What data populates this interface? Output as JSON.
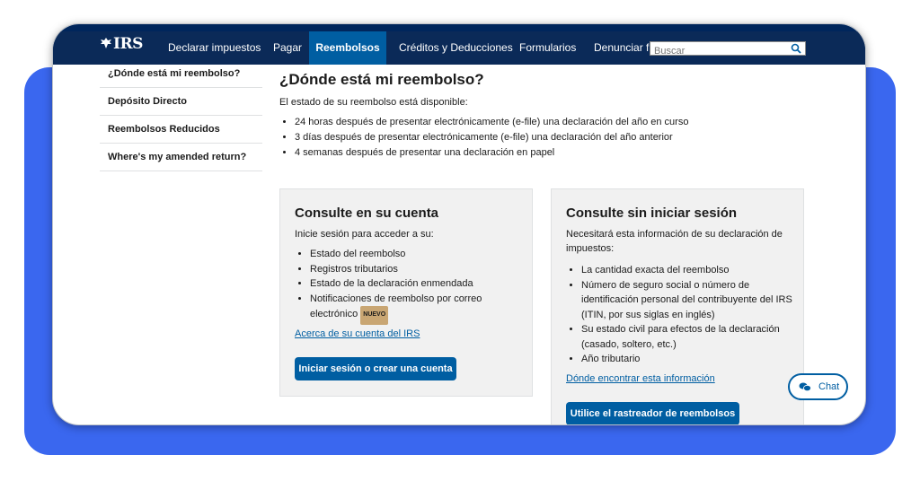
{
  "nav": {
    "logo": "IRS",
    "items": [
      {
        "label": "Declarar impuestos",
        "active": false
      },
      {
        "label": "Pagar",
        "active": false
      },
      {
        "label": "Reembolsos",
        "active": true
      },
      {
        "label": "Créditos y Deducciones",
        "active": false
      },
      {
        "label": "Formularios",
        "active": false
      },
      {
        "label": "Denunciar fra",
        "active": false
      }
    ],
    "search_placeholder": "Buscar"
  },
  "sidebar": {
    "items": [
      {
        "label": "¿Dónde está mi reembolso?"
      },
      {
        "label": "Depósito Directo"
      },
      {
        "label": "Reembolsos Reducidos"
      },
      {
        "label": "Where's my amended return?"
      }
    ]
  },
  "main": {
    "title": "¿Dónde está mi reembolso?",
    "intro": "El estado de su reembolso está disponible:",
    "bullets": [
      "24 horas después de presentar electrónicamente (e-file) una declaración del año en curso",
      "3 días después de presentar electrónicamente (e-file) una declaración del año anterior",
      "4 semanas después de presentar una declaración en papel"
    ]
  },
  "card_account": {
    "title": "Consulte en su cuenta",
    "intro": "Inicie sesión para acceder a su:",
    "items": [
      "Estado del reembolso",
      "Registros tributarios",
      "Estado de la declaración enmendada",
      "Notificaciones de reembolso por correo electrónico"
    ],
    "badge": "NUEVO",
    "link": "Acerca de su cuenta del IRS",
    "button": "Iniciar sesión o crear una cuenta"
  },
  "card_nologin": {
    "title": "Consulte sin iniciar sesión",
    "intro": "Necesitará esta información de su declaración de impuestos:",
    "items": [
      "La cantidad exacta del reembolso",
      "Número de seguro social o número de identificación personal del contribuyente del IRS (ITIN, por sus siglas en inglés)",
      "Su estado civil para efectos de la declaración (casado, soltero, etc.)",
      "Año tributario"
    ],
    "link": "Dónde encontrar esta información",
    "button": "Utilice el rastreador de reembolsos"
  },
  "chat": {
    "label": "Chat"
  },
  "colors": {
    "nav": "#0b2a58",
    "active": "#005ea2",
    "background_accent": "#3a67ef"
  }
}
